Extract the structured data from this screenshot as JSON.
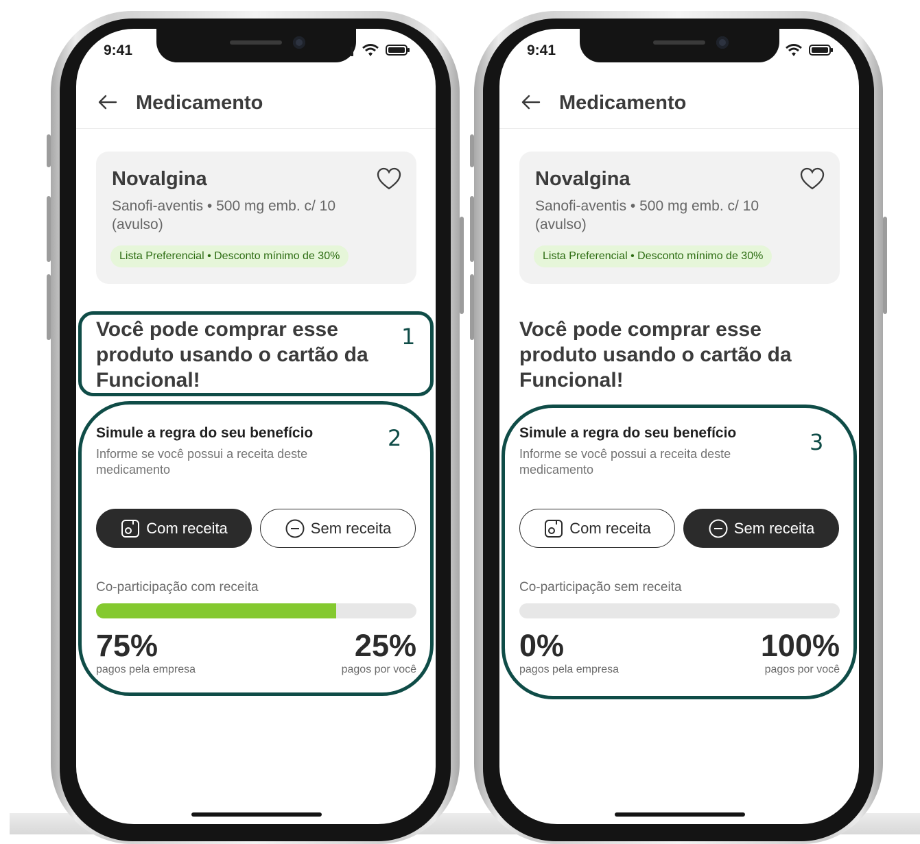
{
  "status_bar": {
    "time": "9:41"
  },
  "header": {
    "title": "Medicamento"
  },
  "product": {
    "name": "Novalgina",
    "description": "Sanofi-aventis • 500 mg emb. c/ 10 (avulso)",
    "badge": "Lista Preferencial • Desconto mínimo de 30%"
  },
  "headline": "Você pode comprar esse produto usando o cartão da Funcional!",
  "simulation": {
    "title": "Simule a regra do seu benefício",
    "subtitle": "Informe se você possui a receita deste medicamento",
    "with_prescription_label": "Com receita",
    "without_prescription_label": "Sem receita",
    "company_caption": "pagos pela empresa",
    "user_caption": "pagos por você"
  },
  "screens": [
    {
      "selected_option": "com-receita",
      "copart_label": "Co-participação com receita",
      "company_share": 0.75,
      "company_percent": "75%",
      "user_percent": "25%"
    },
    {
      "selected_option": "sem-receita",
      "copart_label": "Co-participação sem receita",
      "company_share": 0.0,
      "company_percent": "0%",
      "user_percent": "100%"
    }
  ],
  "annotations": [
    "1",
    "2",
    "3"
  ],
  "colors": {
    "progress_fill": "#84c92f",
    "badge_bg": "#e6f6d9",
    "badge_text": "#2b6b10",
    "annotation": "#0f4c47",
    "button_active": "#2b2b2b"
  }
}
